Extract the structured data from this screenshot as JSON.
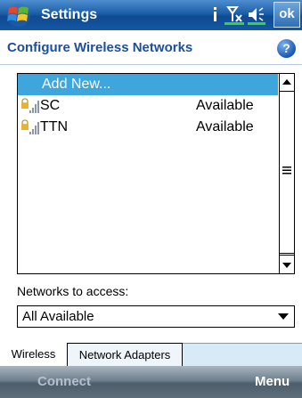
{
  "titlebar": {
    "title": "Settings",
    "ok_label": "ok",
    "icons": [
      "windows-start-icon",
      "connectivity-icon",
      "signal-off-icon",
      "volume-icon"
    ]
  },
  "header": {
    "title": "Configure Wireless Networks",
    "help_icon": "?"
  },
  "network_list": {
    "add_new_label": "Add New...",
    "items": [
      {
        "name": "SC",
        "status": "Available",
        "icon": "wireless-signal-icon"
      },
      {
        "name": "TTN",
        "status": "Available",
        "icon": "wireless-signal-icon"
      }
    ]
  },
  "access": {
    "label": "Networks to access:",
    "selected": "All Available"
  },
  "tabs": [
    {
      "label": "Wireless",
      "active": true
    },
    {
      "label": "Network Adapters",
      "active": false
    }
  ],
  "softkeys": {
    "left": "Connect",
    "right": "Menu"
  },
  "colors": {
    "titlebar": "#1b5ea8",
    "selection": "#3ea6dc",
    "header_text": "#1b4f9a",
    "softkey_bar": "#5e6d7a"
  }
}
